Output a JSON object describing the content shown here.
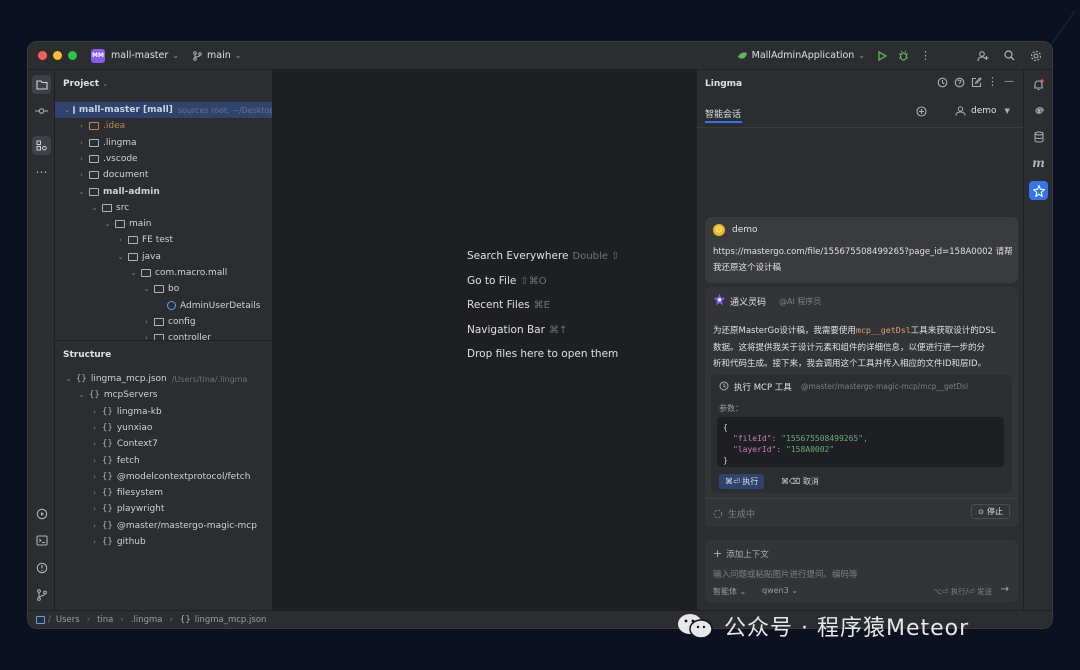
{
  "titlebar": {
    "project_badge": "MM",
    "project_name": "mall-master",
    "branch": "main",
    "run_config": "MallAdminApplication"
  },
  "project_panel": {
    "title": "Project",
    "tree": [
      {
        "label": "mall-master [mall]",
        "extra": "sources root, ~/Desktop/",
        "depth": 0,
        "open": true,
        "bold": true,
        "selected": true
      },
      {
        "label": ".idea",
        "depth": 1,
        "open": false,
        "color": "#c0874a"
      },
      {
        "label": ".lingma",
        "depth": 1,
        "open": false
      },
      {
        "label": ".vscode",
        "depth": 1,
        "open": false
      },
      {
        "label": "document",
        "depth": 1,
        "open": false
      },
      {
        "label": "mall-admin",
        "depth": 1,
        "open": true,
        "bold": true
      },
      {
        "label": "src",
        "depth": 2,
        "open": true
      },
      {
        "label": "main",
        "depth": 3,
        "open": true
      },
      {
        "label": "FE test",
        "depth": 4,
        "open": false
      },
      {
        "label": "java",
        "depth": 4,
        "open": true
      },
      {
        "label": "com.macro.mall",
        "depth": 5,
        "open": true
      },
      {
        "label": "bo",
        "depth": 6,
        "open": true
      },
      {
        "label": "AdminUserDetails",
        "depth": 7,
        "class": true
      },
      {
        "label": "config",
        "depth": 6,
        "open": false
      },
      {
        "label": "controller",
        "depth": 6,
        "open": false
      }
    ]
  },
  "structure_panel": {
    "title": "Structure",
    "tree": [
      {
        "label": "lingma_mcp.json",
        "extra": "/Users/tina/.lingma",
        "depth": 0,
        "open": true
      },
      {
        "label": "mcpServers",
        "depth": 1,
        "open": true
      },
      {
        "label": "lingma-kb",
        "depth": 2,
        "open": false
      },
      {
        "label": "yunxiao",
        "depth": 2,
        "open": false
      },
      {
        "label": "Context7",
        "depth": 2,
        "open": false
      },
      {
        "label": "fetch",
        "depth": 2,
        "open": false
      },
      {
        "label": "@modelcontextprotocol/fetch",
        "depth": 2,
        "open": false
      },
      {
        "label": "filesystem",
        "depth": 2,
        "open": false
      },
      {
        "label": "playwright",
        "depth": 2,
        "open": false
      },
      {
        "label": "@master/mastergo-magic-mcp",
        "depth": 2,
        "open": false
      },
      {
        "label": "github",
        "depth": 2,
        "open": false
      }
    ]
  },
  "editor": {
    "hints": [
      {
        "label": "Search Everywhere",
        "shortcut": "Double ⇧"
      },
      {
        "label": "Go to File",
        "shortcut": "⇧⌘O"
      },
      {
        "label": "Recent Files",
        "shortcut": "⌘E"
      },
      {
        "label": "Navigation Bar",
        "shortcut": "⌘↑"
      },
      {
        "label": "Drop files here to open them",
        "shortcut": ""
      }
    ]
  },
  "lingma": {
    "title": "Lingma",
    "tab": "智能会话",
    "user_menu": "demo",
    "user_message": {
      "name": "demo",
      "text_line1": "https://mastergo.com/file/155675508499265?page_id=158A0002 请帮",
      "text_line2": "我还原这个设计稿"
    },
    "ai_message": {
      "name": "通义灵码",
      "tag": "@AI 程序员",
      "line1_pre": "为还原MasterGo设计稿，我需要使用",
      "line1_code": "mcp__getDsl",
      "line1_post": "工具来获取设计的DSL",
      "line2": "数据。这将提供我关于设计元素和组件的详细信息，以便进行进一步的分",
      "line3": "析和代码生成。接下来，我会调用这个工具并传入相应的文件ID和层ID。"
    },
    "tool_card": {
      "title": "执行 MCP 工具",
      "path": "@master/mastergo-magic-mcp/mcp__getDsl",
      "params_label": "参数：",
      "code_open": "{",
      "code_line1_key": "\"fileId\":",
      "code_line1_val": "\"155675508499265\",",
      "code_line2_key": "\"layerId\":",
      "code_line2_val": "\"158A0002\"",
      "code_close": "}",
      "run_label": "⌘⏎ 执行",
      "cancel_label": "⌘⌫ 取消"
    },
    "generating": "生成中",
    "stop_label": "停止",
    "input": {
      "add_context": "添加上下文",
      "placeholder": "输入问题或粘贴图片进行提问、编码等",
      "mode": "智能体",
      "model": "qwen3",
      "send_hint": "⌥⏎ 执行/⏎ 发送"
    }
  },
  "statusbar": {
    "crumbs": [
      "Users",
      "tina",
      ".lingma",
      "lingma_mcp.json"
    ]
  },
  "watermark": {
    "text": "公众号 · 程序猿Meteor"
  },
  "colors": {
    "accent": "#3574f0",
    "selection": "#2e436e",
    "run_green": "#5fb85f",
    "code_string": "#6aab73",
    "code_key": "#c77dbb"
  }
}
